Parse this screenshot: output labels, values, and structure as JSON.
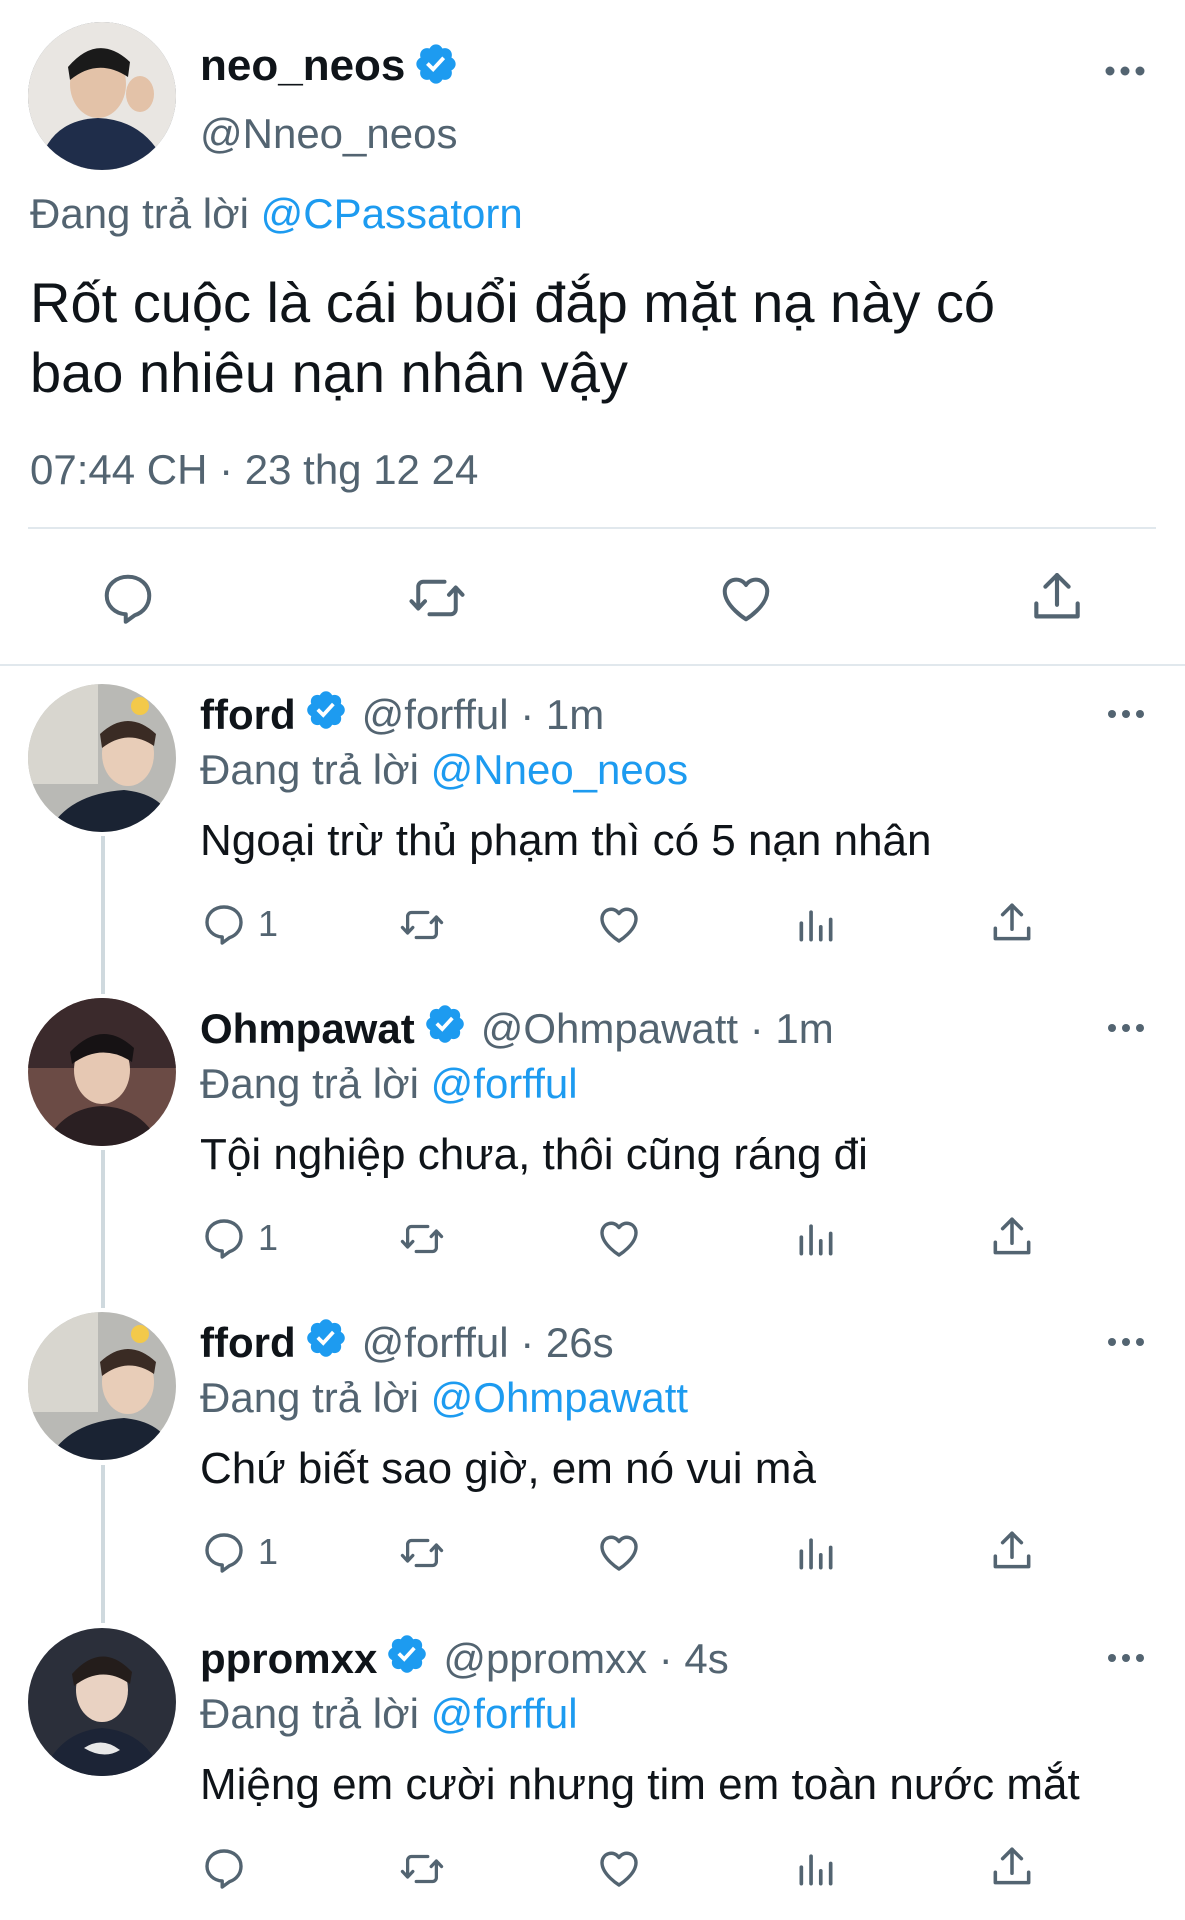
{
  "main_tweet": {
    "display_name": "neo_neos",
    "handle": "@Nneo_neos",
    "replying_prefix": "Đang trả lời",
    "replying_to": "@CPassatorn",
    "text_line1": "Rốt cuộc là cái buổi đắp mặt nạ này có",
    "text_line2": "bao nhiêu nạn nhân vậy",
    "timestamp": "07:44 CH · 23 thg 12 24"
  },
  "replies": [
    {
      "display_name": "fford",
      "meta": "@forfful · 1m",
      "replying_prefix": "Đang trả lời",
      "replying_to": "@Nneo_neos",
      "text": "Ngoại trừ thủ phạm thì có 5 nạn nhân",
      "reply_count": "1"
    },
    {
      "display_name": "Ohmpawat",
      "meta": "@Ohmpawatt · 1m",
      "replying_prefix": "Đang trả lời",
      "replying_to": "@forfful",
      "text": "Tội nghiệp chưa, thôi cũng ráng đi",
      "reply_count": "1"
    },
    {
      "display_name": "fford",
      "meta": "@forfful · 26s",
      "replying_prefix": "Đang trả lời",
      "replying_to": "@Ohmpawatt",
      "text": "Chứ biết sao giờ, em nó vui mà",
      "reply_count": "1"
    },
    {
      "display_name": "ppromxx",
      "meta": "@ppromxx · 4s",
      "replying_prefix": "Đang trả lời",
      "replying_to": "@forfful",
      "text": "Miệng em cười nhưng tim em toàn nước mắt",
      "reply_count": ""
    }
  ],
  "colors": {
    "accent": "#1d9bf0",
    "secondary_text": "#536471",
    "primary_text": "#0f1419",
    "divider": "#e1e8ed"
  }
}
